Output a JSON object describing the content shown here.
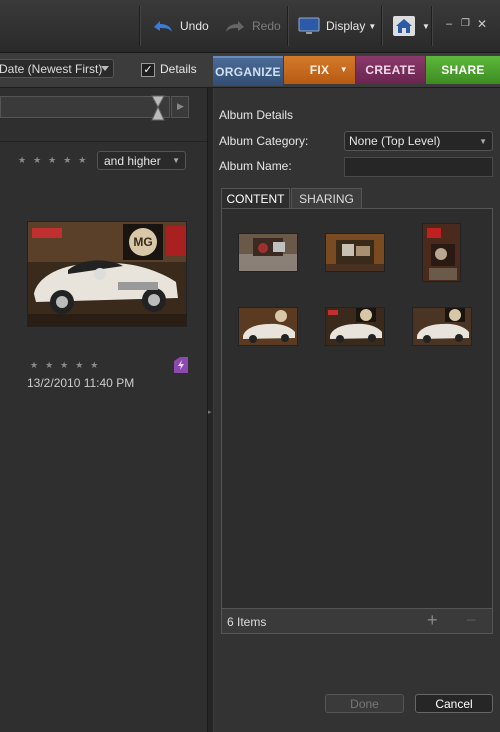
{
  "toolbar": {
    "undo_label": "Undo",
    "redo_label": "Redo",
    "display_label": "Display",
    "window_controls": [
      "minimize-icon",
      "restore-icon",
      "close-icon"
    ]
  },
  "bar2": {
    "sort_value": "Date (Newest First)",
    "details_label": "Details",
    "details_checked": true
  },
  "tabs": [
    {
      "label": "ORGANIZE",
      "color": "#3d5a80"
    },
    {
      "label": "FIX",
      "color": "#c86a1e"
    },
    {
      "label": "CREATE",
      "color": "#7a2d5c"
    },
    {
      "label": "SHARE",
      "color": "#4a9a2a"
    }
  ],
  "left": {
    "rating_filter": "and higher",
    "photo_datetime": "13/2/2010 11:40 PM"
  },
  "album": {
    "title": "Album Details",
    "category_label": "Album Category:",
    "category_value": "None (Top Level)",
    "name_label": "Album Name:",
    "name_value": "",
    "content_tab": "CONTENT",
    "sharing_tab": "SHARING",
    "items_count": "6 Items",
    "done_label": "Done",
    "cancel_label": "Cancel"
  },
  "colors": {
    "organize": "#3d5a80",
    "fix": "#c86a1e",
    "create": "#7a2d5c",
    "share": "#4a9a2a",
    "panel": "#333333"
  }
}
